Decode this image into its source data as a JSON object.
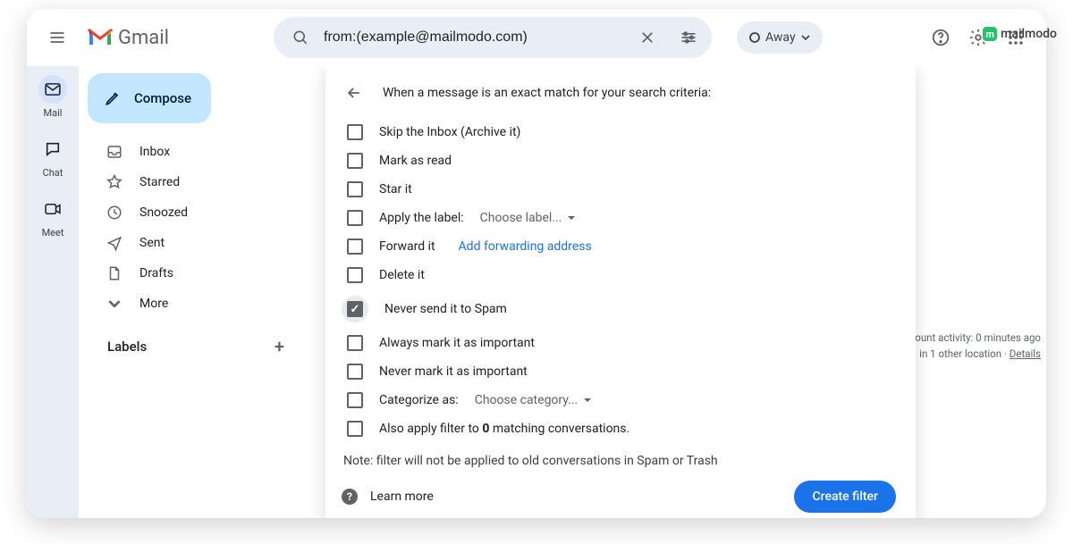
{
  "brand": "Gmail",
  "search": {
    "value": "from:(example@mailmodo.com)"
  },
  "status": {
    "label": "Away"
  },
  "rail": [
    {
      "label": "Mail"
    },
    {
      "label": "Chat"
    },
    {
      "label": "Meet"
    }
  ],
  "compose_label": "Compose",
  "nav": {
    "inbox": "Inbox",
    "starred": "Starred",
    "snoozed": "Snoozed",
    "sent": "Sent",
    "drafts": "Drafts",
    "more": "More"
  },
  "labels_header": "Labels",
  "filter": {
    "heading": "When a message is an exact match for your search criteria:",
    "options": {
      "skip_inbox": "Skip the Inbox (Archive it)",
      "mark_read": "Mark as read",
      "star": "Star it",
      "apply_label": "Apply the label:",
      "apply_label_choose": "Choose label...",
      "forward": "Forward it",
      "forward_link": "Add forwarding address",
      "delete": "Delete it",
      "never_spam": "Never send it to Spam",
      "always_important": "Always mark it as important",
      "never_important": "Never mark it as important",
      "categorize": "Categorize as:",
      "categorize_choose": "Choose category...",
      "also_apply_prefix": "Also apply filter to ",
      "also_apply_count": "0",
      "also_apply_suffix": " matching conversations."
    },
    "note": "Note: filter will not be applied to old conversations in Spam or Trash",
    "learn_more": "Learn more",
    "create": "Create filter"
  },
  "activity": {
    "line1": "ount activity: 0 minutes ago",
    "line2_prefix": "in 1 other location · ",
    "details": "Details"
  },
  "ext_brand": "mailmodo"
}
